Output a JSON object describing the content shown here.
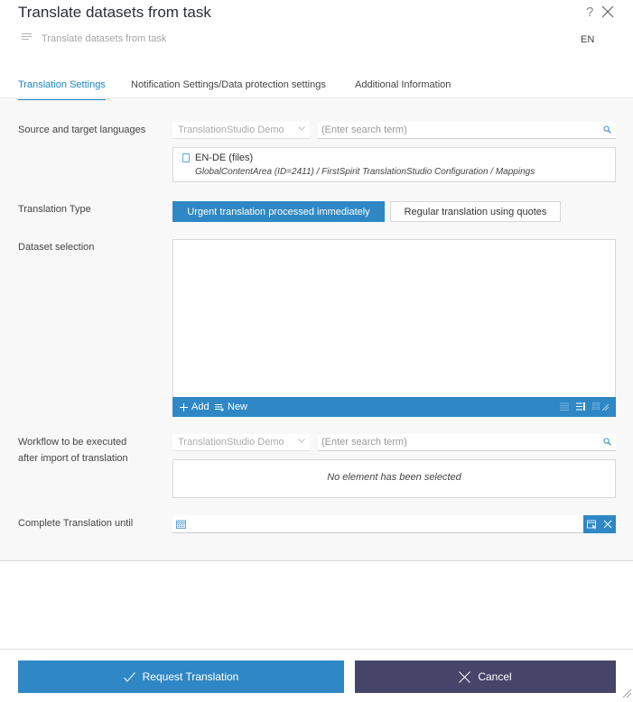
{
  "header": {
    "title": "Translate datasets from task",
    "subtitle": "Translate datasets from task",
    "help_label": "?",
    "language": "EN"
  },
  "tabs": [
    {
      "label": "Translation Settings",
      "active": true
    },
    {
      "label": "Notification Settings/Data protection settings",
      "active": false
    },
    {
      "label": "Additional Information",
      "active": false
    }
  ],
  "form": {
    "languages": {
      "label": "Source and target languages",
      "project_select": "TranslationStudio Demo",
      "search_placeholder": "(Enter search term)",
      "selected_item": {
        "title": "EN-DE (files)",
        "path": "GlobalContentArea (ID=2411) / FirstSpirit TranslationStudio Configuration / Mappings"
      }
    },
    "translation_type": {
      "label": "Translation Type",
      "options": [
        {
          "label": "Urgent translation processed immediately",
          "selected": true
        },
        {
          "label": "Regular translation using quotes",
          "selected": false
        }
      ]
    },
    "dataset_selection": {
      "label": "Dataset selection",
      "toolbar": {
        "add_label": "Add",
        "new_label": "New"
      }
    },
    "workflow": {
      "label_line1": "Workflow to be executed",
      "label_line2": "after import of translation",
      "project_select": "TranslationStudio Demo",
      "search_placeholder": "(Enter search term)",
      "empty_text": "No element has been selected"
    },
    "complete_until": {
      "label": "Complete Translation until",
      "value": ""
    }
  },
  "footer": {
    "request_label": "Request Translation",
    "cancel_label": "Cancel"
  },
  "colors": {
    "accent": "#2f88c5",
    "tab_active": "#1a86c8",
    "cancel": "#474469"
  }
}
